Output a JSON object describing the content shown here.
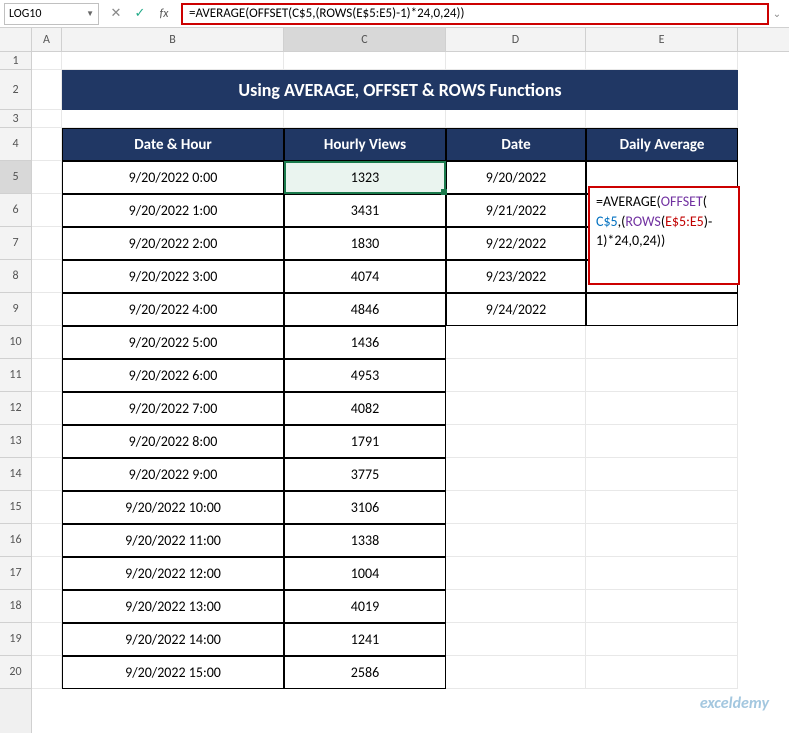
{
  "name_box": "LOG10",
  "formula": "=AVERAGE(OFFSET(C$5,(ROWS(E$5:E5)-1)*24,0,24))",
  "col_headers": [
    "A",
    "B",
    "C",
    "D",
    "E"
  ],
  "row_headers": [
    "1",
    "2",
    "3",
    "4",
    "5",
    "6",
    "7",
    "8",
    "9",
    "10",
    "11",
    "12",
    "13",
    "14",
    "15",
    "16",
    "17",
    "18",
    "19",
    "20"
  ],
  "title": "Using AVERAGE, OFFSET & ROWS Functions",
  "headers": {
    "b": "Date & Hour",
    "c": "Hourly Views",
    "d": "Date",
    "e": "Daily Average"
  },
  "table": [
    {
      "b": "9/20/2022 0:00",
      "c": "1323",
      "d": "9/20/2022"
    },
    {
      "b": "9/20/2022 1:00",
      "c": "3431",
      "d": "9/21/2022"
    },
    {
      "b": "9/20/2022 2:00",
      "c": "1830",
      "d": "9/22/2022"
    },
    {
      "b": "9/20/2022 3:00",
      "c": "4074",
      "d": "9/23/2022"
    },
    {
      "b": "9/20/2022 4:00",
      "c": "4846",
      "d": "9/24/2022"
    },
    {
      "b": "9/20/2022 5:00",
      "c": "1436",
      "d": ""
    },
    {
      "b": "9/20/2022 6:00",
      "c": "4953",
      "d": ""
    },
    {
      "b": "9/20/2022 7:00",
      "c": "4082",
      "d": ""
    },
    {
      "b": "9/20/2022 8:00",
      "c": "1791",
      "d": ""
    },
    {
      "b": "9/20/2022 9:00",
      "c": "3775",
      "d": ""
    },
    {
      "b": "9/20/2022 10:00",
      "c": "3106",
      "d": ""
    },
    {
      "b": "9/20/2022 11:00",
      "c": "1338",
      "d": ""
    },
    {
      "b": "9/20/2022 12:00",
      "c": "1004",
      "d": ""
    },
    {
      "b": "9/20/2022 13:00",
      "c": "4019",
      "d": ""
    },
    {
      "b": "9/20/2022 14:00",
      "c": "1241",
      "d": ""
    },
    {
      "b": "9/20/2022 15:00",
      "c": "2586",
      "d": ""
    }
  ],
  "overlay": {
    "p1a": "=AVERAGE(",
    "p1b": "OFFSET",
    "p1c": "(",
    "p2a": "C$5",
    "p2b": ",(",
    "p2c": "ROWS",
    "p2d": "(",
    "p2e": "E$5:E5",
    "p2f": ")-",
    "p3a": "1)*24,0,24)",
    "p3b": ")"
  },
  "watermark": "exceldemy"
}
